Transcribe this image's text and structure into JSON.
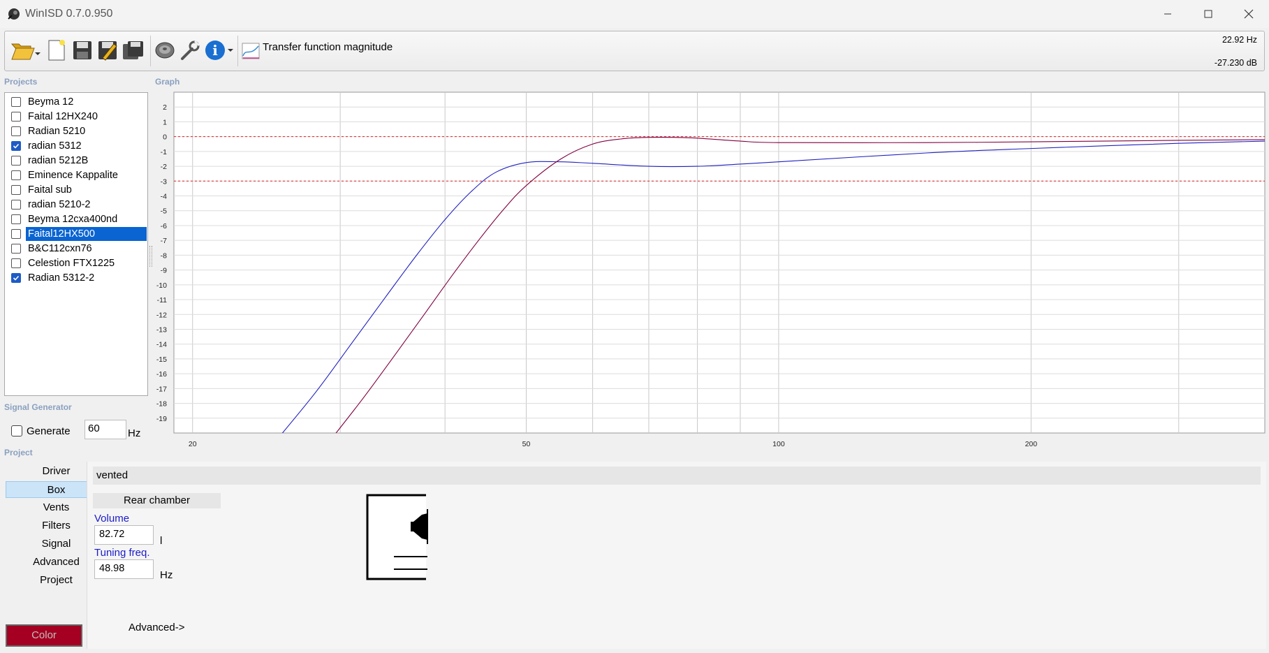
{
  "window": {
    "title": "WinISD 0.7.0.950"
  },
  "toolbar": {
    "transfer_function_label": "Transfer function magnitude",
    "cursor_freq": "22.92 Hz",
    "cursor_db": "-27.230 dB",
    "icons": [
      "open-folder-icon",
      "new-document-icon",
      "save-icon",
      "save-as-icon",
      "save-all-icon",
      "driver-icon",
      "wrench-icon",
      "info-icon",
      "graph-icon"
    ]
  },
  "projects": {
    "label": "Projects",
    "items": [
      {
        "label": "Beyma 12",
        "checked": false
      },
      {
        "label": "Faital 12HX240",
        "checked": false
      },
      {
        "label": "Radian 5210",
        "checked": false
      },
      {
        "label": "radian 5312",
        "checked": true
      },
      {
        "label": "radian 5212B",
        "checked": false
      },
      {
        "label": "Eminence Kappalite",
        "checked": false
      },
      {
        "label": "Faital sub",
        "checked": false
      },
      {
        "label": "radian 5210-2",
        "checked": false
      },
      {
        "label": "Beyma 12cxa400nd",
        "checked": false
      },
      {
        "label": "Faital12HX500",
        "checked": false,
        "selected": true
      },
      {
        "label": "B&C112cxn76",
        "checked": false
      },
      {
        "label": "Celestion FTX1225",
        "checked": false
      },
      {
        "label": "Radian 5312-2",
        "checked": true
      }
    ]
  },
  "graph": {
    "label": "Graph"
  },
  "signal_generator": {
    "label": "Signal Generator",
    "generate_label": "Generate",
    "generate_checked": false,
    "frequency": "60",
    "unit": "Hz"
  },
  "project_panel": {
    "label": "Project",
    "nav": [
      "Driver",
      "Box",
      "Vents",
      "Filters",
      "Signal",
      "Advanced",
      "Project"
    ],
    "active": "Box",
    "color_button": "Color",
    "color_value": "#a50021"
  },
  "box": {
    "type": "vented",
    "chamber_label": "Rear chamber",
    "volume_label": "Volume",
    "volume_value": "82.72",
    "volume_unit": "l",
    "tuning_label": "Tuning freq.",
    "tuning_value": "48.98",
    "tuning_unit": "Hz",
    "advanced_link": "Advanced->"
  },
  "chart_data": {
    "type": "line",
    "title": "",
    "xlabel": "",
    "ylabel": "",
    "x_scale": "log",
    "xlim": [
      19,
      380
    ],
    "ylim": [
      -20,
      3
    ],
    "x_ticks": [
      20,
      50,
      100,
      200
    ],
    "y_ticks": [
      2,
      1,
      0,
      -1,
      -2,
      -3,
      -4,
      -5,
      -6,
      -7,
      -8,
      -9,
      -10,
      -11,
      -12,
      -13,
      -14,
      -15,
      -16,
      -17,
      -18,
      -19
    ],
    "reference_lines_db": [
      0,
      -3
    ],
    "reference_color": "#e02020",
    "grid": true,
    "series": [
      {
        "color": "#2020c0",
        "x": [
          25,
          28,
          31,
          34,
          37,
          40,
          43,
          46,
          50,
          55,
          60,
          70,
          80,
          90,
          100,
          150,
          200,
          300,
          380
        ],
        "y": [
          -20.7,
          -17.3,
          -13.9,
          -10.8,
          -8.0,
          -5.6,
          -3.7,
          -2.4,
          -1.75,
          -1.7,
          -1.8,
          -2.0,
          -2.0,
          -1.85,
          -1.7,
          -1.1,
          -0.8,
          -0.45,
          -0.3
        ]
      },
      {
        "color": "#800040",
        "x": [
          29,
          32,
          35,
          38,
          41,
          44,
          47,
          50,
          55,
          60,
          65,
          70,
          75,
          80,
          90,
          100,
          150,
          200,
          300,
          380
        ],
        "y": [
          -20.7,
          -17.6,
          -14.6,
          -11.8,
          -9.2,
          -6.9,
          -4.9,
          -3.3,
          -1.5,
          -0.5,
          -0.15,
          -0.05,
          -0.05,
          -0.1,
          -0.3,
          -0.4,
          -0.4,
          -0.35,
          -0.25,
          -0.2
        ]
      }
    ]
  }
}
